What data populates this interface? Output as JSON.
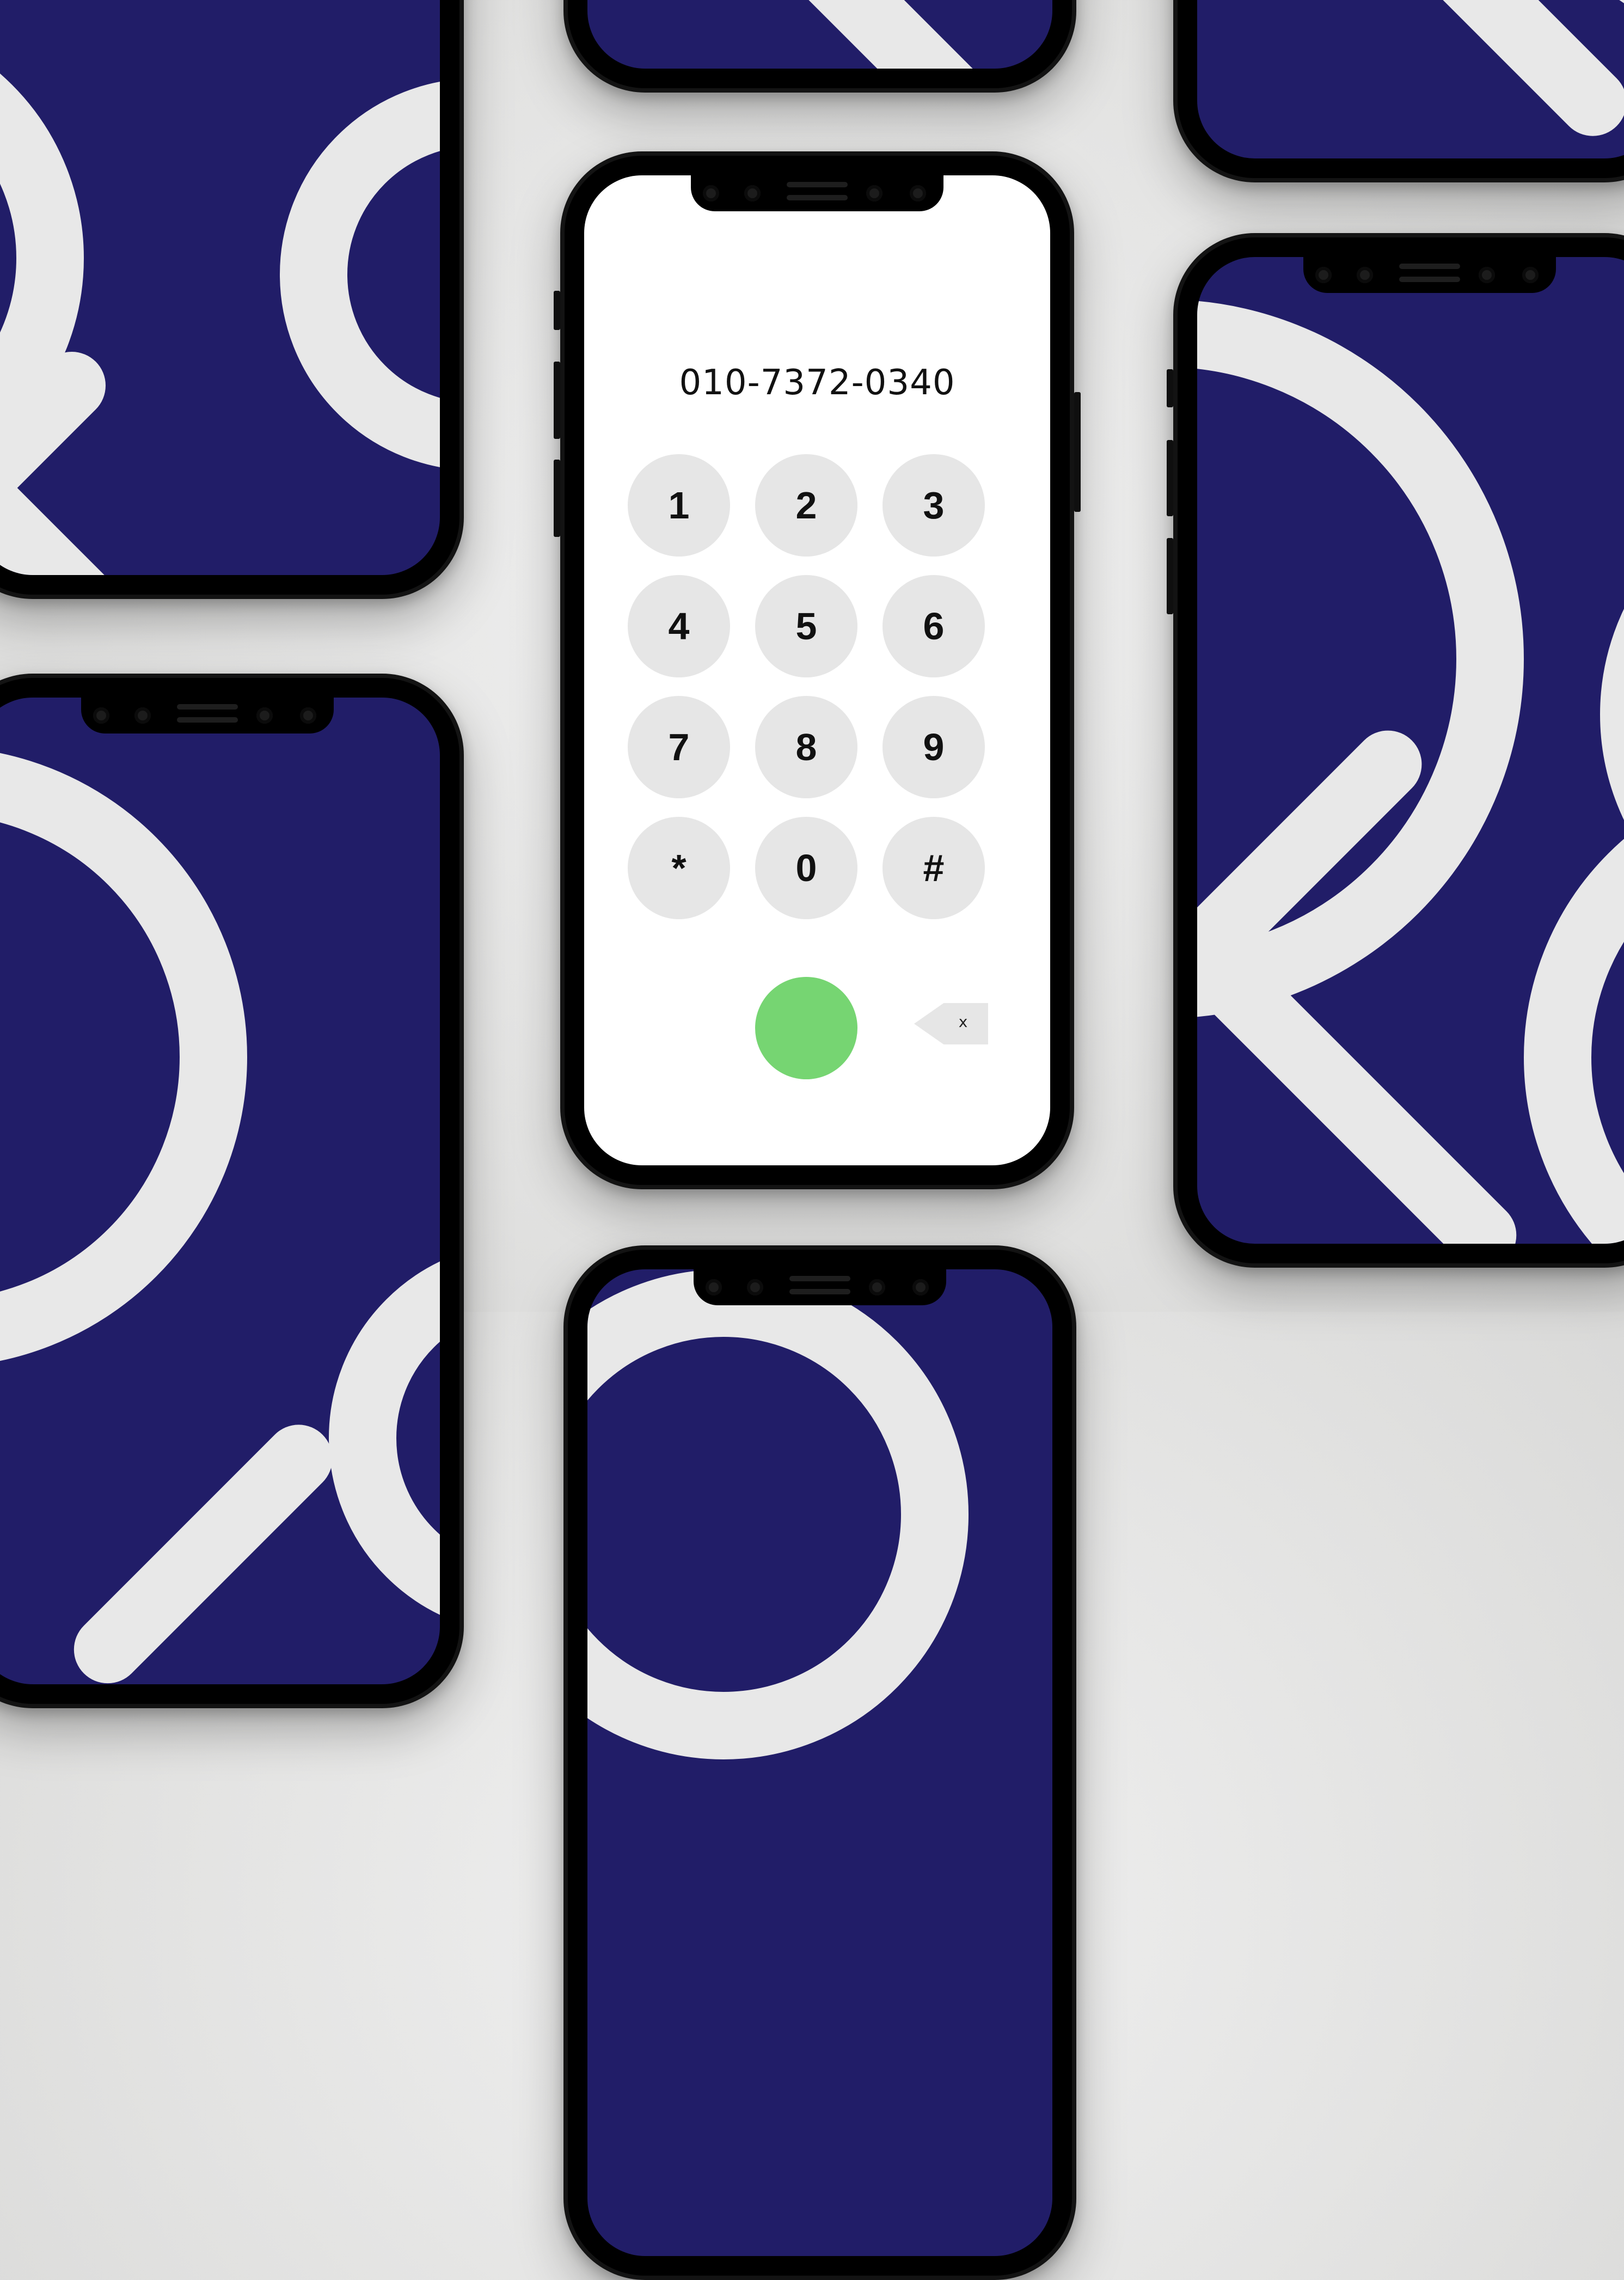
{
  "dialer": {
    "number": "010-7372-0340",
    "keys": [
      "1",
      "2",
      "3",
      "4",
      "5",
      "6",
      "7",
      "8",
      "9",
      "*",
      "0",
      "#"
    ],
    "backspace_label": "x"
  },
  "colors": {
    "background": "#e2e2e1",
    "wallpaper_navy": "#211d68",
    "wallpaper_pattern": "#e8e8e8",
    "key_gray": "#e6e6e6",
    "call_green": "#76d572"
  },
  "icons": {
    "call": "phone-call-icon",
    "backspace": "backspace-icon"
  }
}
